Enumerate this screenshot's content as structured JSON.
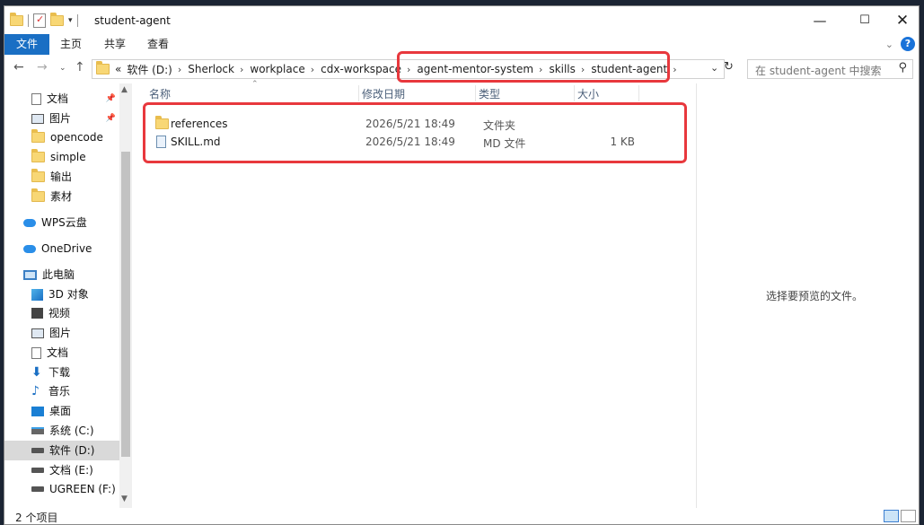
{
  "window": {
    "title": "student-agent"
  },
  "ribbon": {
    "tabs": [
      "文件",
      "主页",
      "共享",
      "查看"
    ]
  },
  "address": {
    "prefix": "«",
    "crumbs": [
      "软件 (D:)",
      "Sherlock",
      "workplace",
      "cdx-workspace",
      "agent-mentor-system",
      "skills",
      "student-agent"
    ]
  },
  "search": {
    "placeholder": "在 student-agent 中搜索"
  },
  "nav": {
    "items": [
      {
        "label": "文档",
        "icon": "document-icon",
        "pinned": true
      },
      {
        "label": "图片",
        "icon": "pictures-icon",
        "pinned": true
      },
      {
        "label": "opencode",
        "icon": "folder-icon"
      },
      {
        "label": "simple",
        "icon": "folder-icon"
      },
      {
        "label": "输出",
        "icon": "folder-icon"
      },
      {
        "label": "素材",
        "icon": "folder-icon"
      },
      {
        "label": "WPS云盘",
        "icon": "cloud-icon"
      },
      {
        "label": "OneDrive",
        "icon": "cloud-icon"
      },
      {
        "label": "此电脑",
        "icon": "computer-icon"
      },
      {
        "label": "3D 对象",
        "icon": "3d-objects-icon"
      },
      {
        "label": "视频",
        "icon": "video-icon"
      },
      {
        "label": "图片",
        "icon": "pictures-icon"
      },
      {
        "label": "文档",
        "icon": "document-icon"
      },
      {
        "label": "下载",
        "icon": "download-icon"
      },
      {
        "label": "音乐",
        "icon": "music-icon"
      },
      {
        "label": "桌面",
        "icon": "desktop-icon"
      },
      {
        "label": "系统 (C:)",
        "icon": "system-drive-icon"
      },
      {
        "label": "软件 (D:)",
        "icon": "drive-icon",
        "selected": true
      },
      {
        "label": "文档 (E:)",
        "icon": "drive-icon"
      },
      {
        "label": "UGREEN (F:)",
        "icon": "drive-icon"
      }
    ]
  },
  "columns": {
    "name": "名称",
    "modified": "修改日期",
    "type": "类型",
    "size": "大小"
  },
  "files": [
    {
      "name": "references",
      "modified": "2026/5/21 18:49",
      "type": "文件夹",
      "size": "",
      "icon": "folder-icon"
    },
    {
      "name": "SKILL.md",
      "modified": "2026/5/21 18:49",
      "type": "MD 文件",
      "size": "1 KB",
      "icon": "file-icon"
    }
  ],
  "preview": {
    "message": "选择要预览的文件。"
  },
  "status": {
    "count": "2 个项目"
  },
  "highlight_color": "#e8383d",
  "accent_color": "#1a6fc4"
}
